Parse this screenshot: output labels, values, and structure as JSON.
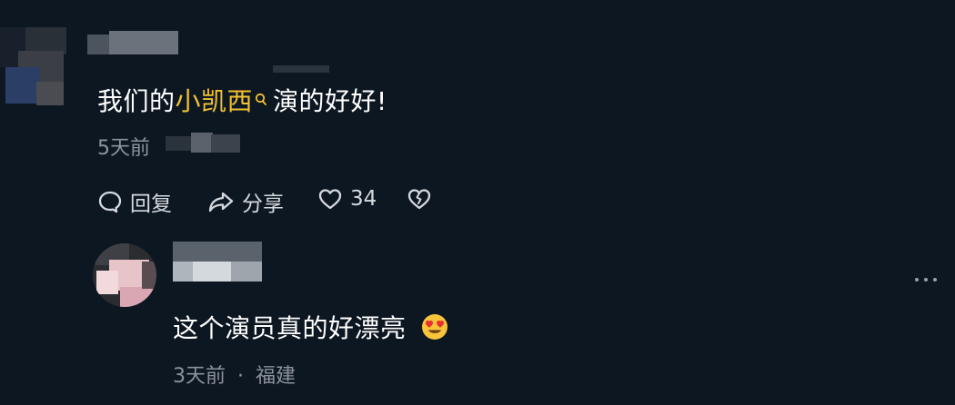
{
  "comment1": {
    "text_prefix": "我们的",
    "keyword": "小凯西",
    "text_suffix": "演的好好!",
    "time": "5天前",
    "actions": {
      "reply": "回复",
      "share": "分享",
      "like_count": "34"
    }
  },
  "comment2": {
    "text": "这个演员真的好漂亮",
    "time": "3天前",
    "separator": "·",
    "location": "福建"
  },
  "colors": {
    "background": "#0d1722",
    "keyword": "#f2c230",
    "meta_text": "#8c939c"
  },
  "icons": [
    "search-icon",
    "reply-icon",
    "share-icon",
    "heart-icon",
    "dislike-icon",
    "more-icon",
    "heart-eyes-emoji"
  ]
}
